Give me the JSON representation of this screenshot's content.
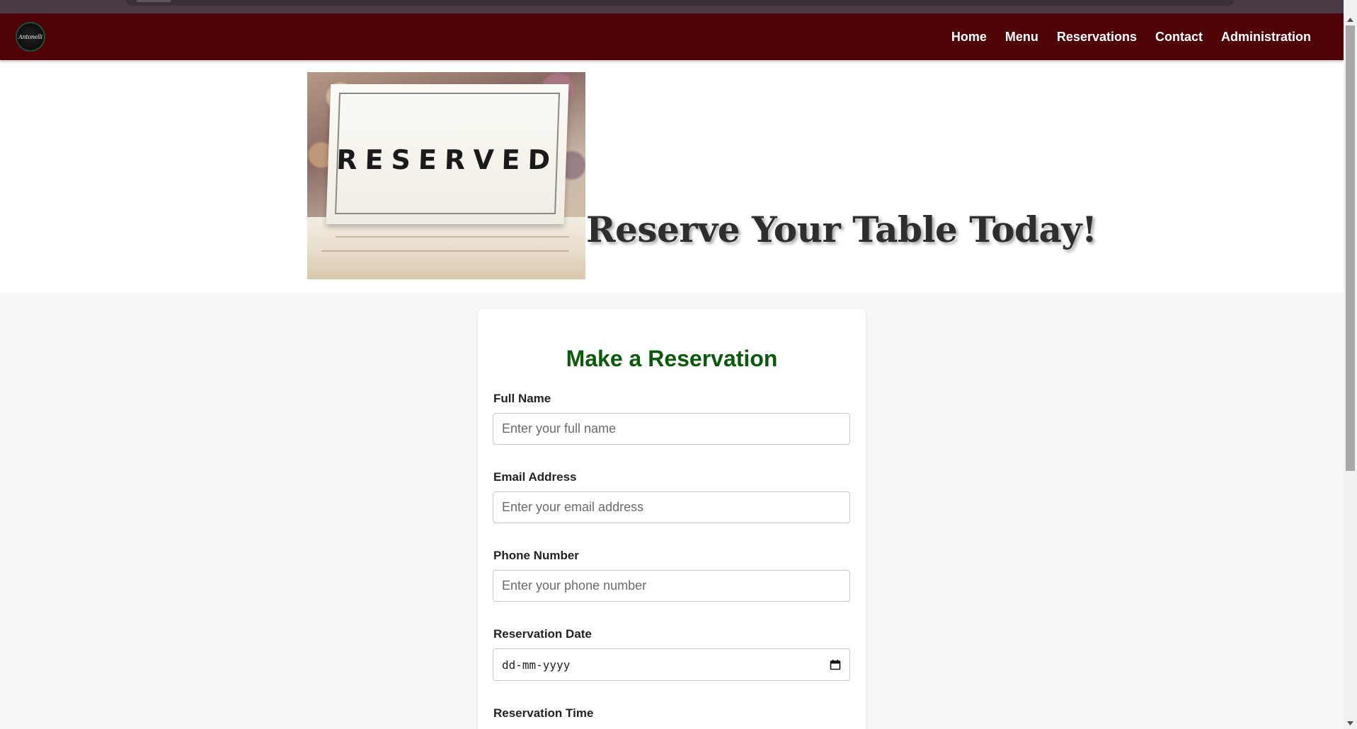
{
  "nav": {
    "logo_text": "Antonelli",
    "links": [
      {
        "label": "Home"
      },
      {
        "label": "Menu"
      },
      {
        "label": "Reservations"
      },
      {
        "label": "Contact"
      },
      {
        "label": "Administration"
      }
    ]
  },
  "hero": {
    "sign_text": "RESERVED",
    "title": "Reserve Your Table Today!"
  },
  "form": {
    "title": "Make a Reservation",
    "full_name": {
      "label": "Full Name",
      "placeholder": "Enter your full name",
      "value": ""
    },
    "email": {
      "label": "Email Address",
      "placeholder": "Enter your email address",
      "value": ""
    },
    "phone": {
      "label": "Phone Number",
      "placeholder": "Enter your phone number",
      "value": ""
    },
    "date": {
      "label": "Reservation Date",
      "placeholder": "dd-mm-yyyy"
    },
    "time": {
      "label": "Reservation Time"
    }
  },
  "colors": {
    "navbar": "#4f0307",
    "form_title": "#0b5a0b",
    "page_bg": "#f7f7f7"
  }
}
